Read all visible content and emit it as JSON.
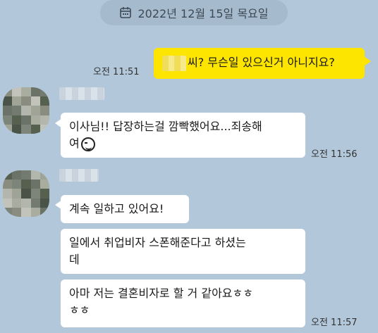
{
  "date_divider": {
    "icon": "calendar-icon",
    "text": "2022년 12월 15일 목요일"
  },
  "messages": {
    "outgoing": {
      "redacted_name": true,
      "text": "씨? 무슨일 있으신거 아니지요?",
      "time": "오전 11:51"
    },
    "group1": {
      "line1": "이사님!! 답장하는걸 깜빡했어요...죄송해",
      "line2": "여",
      "emoji": "smirk-face-icon",
      "time": "오전 11:56"
    },
    "group2": {
      "msg1": "계속 일하고 있어요!",
      "msg2_line1": "일에서 취업비자 스폰해준다고 하셨는",
      "msg2_line2": "데",
      "msg3_line1": "아마 저는 결혼비자로 할 거 같아요ㅎㅎ",
      "msg3_line2": "ㅎㅎ",
      "time": "오전 11:57"
    }
  },
  "colors": {
    "background": "#b2c7da",
    "my_bubble": "#fee500",
    "other_bubble": "#ffffff"
  }
}
